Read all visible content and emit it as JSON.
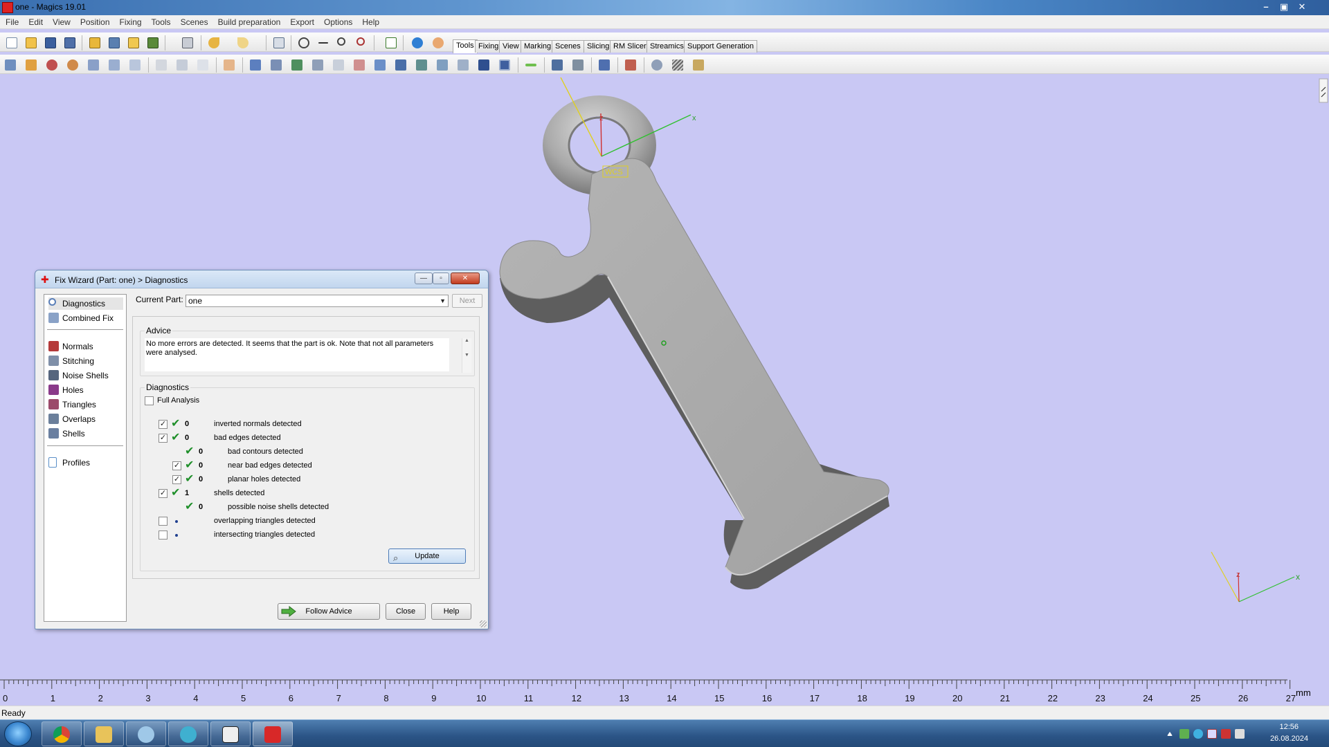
{
  "window": {
    "title": "one - Magics 19.01",
    "min": "–",
    "restore": "▣",
    "close": "✕"
  },
  "menu": [
    "File",
    "Edit",
    "View",
    "Position",
    "Fixing",
    "Tools",
    "Scenes",
    "Build preparation",
    "Export",
    "Options",
    "Help"
  ],
  "tabs": [
    "Tools",
    "Fixing",
    "View",
    "Marking",
    "Scenes",
    "Slicing",
    "RM Slicer",
    "Streamics",
    "Support Generation"
  ],
  "active_tab": "Tools",
  "viewport": {
    "wcs_label": "WCS",
    "axis_x": "x",
    "axis_z": "z"
  },
  "ruler": {
    "ticks": [
      "0",
      "1",
      "2",
      "3",
      "4",
      "5",
      "6",
      "7",
      "8",
      "9",
      "10",
      "11",
      "12",
      "13",
      "14",
      "15",
      "16",
      "17",
      "18",
      "19",
      "20",
      "21",
      "22",
      "23",
      "24",
      "25",
      "26",
      "27"
    ],
    "unit": "mm"
  },
  "status": "Ready",
  "dialog": {
    "title": "Fix Wizard (Part: one) > Diagnostics",
    "nav": [
      {
        "label": "Diagnostics",
        "icon": "magnifier-icon",
        "color": "#5b7fb8"
      },
      {
        "label": "Combined Fix",
        "icon": "combined-fix-icon",
        "color": "#8aa2c7"
      },
      {
        "label": "Normals",
        "icon": "normals-icon",
        "color": "#b53a3a"
      },
      {
        "label": "Stitching",
        "icon": "stitching-icon",
        "color": "#7f8fa8"
      },
      {
        "label": "Noise Shells",
        "icon": "noise-shells-icon",
        "color": "#55657d"
      },
      {
        "label": "Holes",
        "icon": "holes-icon",
        "color": "#8a3a8a"
      },
      {
        "label": "Triangles",
        "icon": "triangles-icon",
        "color": "#9b4a6a"
      },
      {
        "label": "Overlaps",
        "icon": "overlaps-icon",
        "color": "#6b7f9b"
      },
      {
        "label": "Shells",
        "icon": "shells-icon",
        "color": "#6a7fa0"
      },
      {
        "label": "Profiles",
        "icon": "profiles-icon",
        "color": "#5a8fc8"
      }
    ],
    "current_part_label": "Current Part:",
    "current_part_value": "one",
    "next_label": "Next",
    "advice_title": "Advice",
    "advice_text": "No more errors are detected. It seems that the part is ok. Note that not all parameters were analysed.",
    "diagnostics_title": "Diagnostics",
    "full_analysis_label": "Full Analysis",
    "rows": [
      {
        "checked": true,
        "status": "ok",
        "count": "0",
        "label": "inverted normals detected",
        "indent": 0,
        "has_checkbox": true
      },
      {
        "checked": true,
        "status": "ok",
        "count": "0",
        "label": "bad edges detected",
        "indent": 0,
        "has_checkbox": true
      },
      {
        "checked": false,
        "status": "ok",
        "count": "0",
        "label": "bad contours detected",
        "indent": 1,
        "has_checkbox": false
      },
      {
        "checked": true,
        "status": "ok",
        "count": "0",
        "label": "near bad edges detected",
        "indent": 1,
        "has_checkbox": true
      },
      {
        "checked": true,
        "status": "ok",
        "count": "0",
        "label": "planar holes detected",
        "indent": 1,
        "has_checkbox": true
      },
      {
        "checked": true,
        "status": "ok",
        "count": "1",
        "label": "shells detected",
        "indent": 0,
        "has_checkbox": true
      },
      {
        "checked": false,
        "status": "ok",
        "count": "0",
        "label": "possible noise shells detected",
        "indent": 1,
        "has_checkbox": false
      },
      {
        "checked": false,
        "status": "dot",
        "count": "",
        "label": "overlapping triangles detected",
        "indent": 0,
        "has_checkbox": true
      },
      {
        "checked": false,
        "status": "dot",
        "count": "",
        "label": "intersecting triangles detected",
        "indent": 0,
        "has_checkbox": true
      }
    ],
    "update_label": "Update",
    "follow_advice_label": "Follow Advice",
    "close_label": "Close",
    "help_label": "Help"
  },
  "taskbar": {
    "apps": [
      "chrome-icon",
      "explorer-icon",
      "paint-icon",
      "v8-icon",
      "viewer-icon",
      "magics-icon"
    ],
    "time": "12:56",
    "date": "26.08.2024"
  }
}
